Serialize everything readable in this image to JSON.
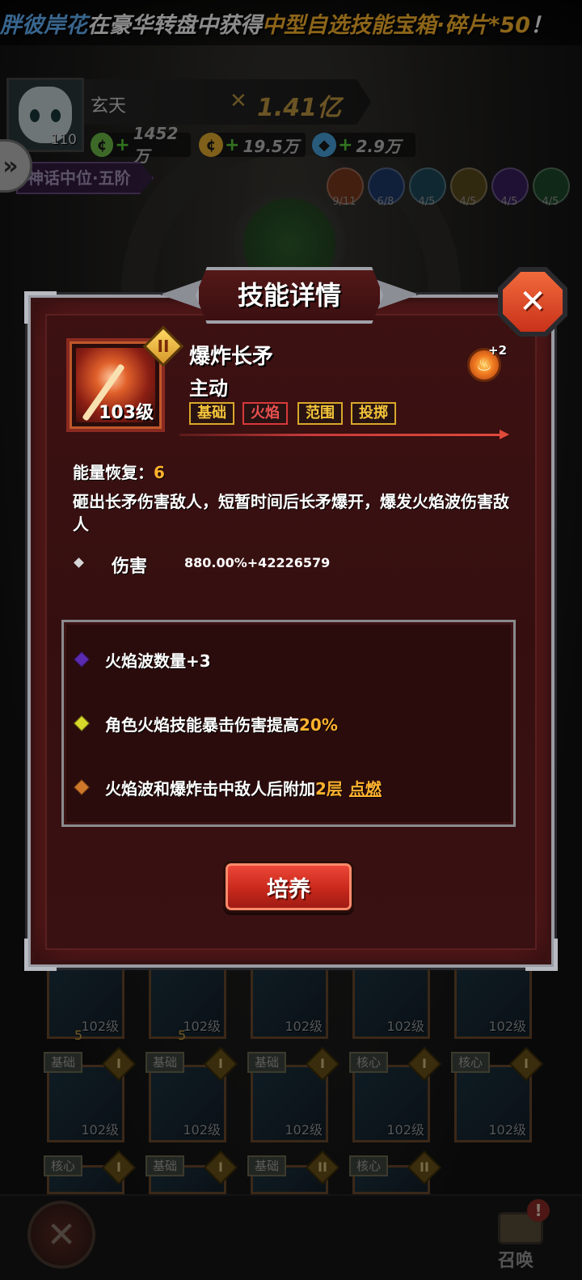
{
  "marquee": {
    "player": "胖彼岸花",
    "text1": "在豪华转盘中获得",
    "prize": "中型自选技能宝箱·碎片*50",
    "bang": "！"
  },
  "player": {
    "name": "玄天",
    "level": "110",
    "power": "1.41亿",
    "resources": [
      {
        "icon": "green-coin-icon",
        "value": "1452万",
        "color": "#6fbf4a"
      },
      {
        "icon": "gold-coin-icon",
        "value": "19.5万",
        "color": "#e8b030"
      },
      {
        "icon": "blue-crystal-icon",
        "value": "2.9万",
        "color": "#4aa6e0"
      }
    ],
    "rank": "神话中位·五阶"
  },
  "elements": [
    {
      "name": "fire",
      "count": "9/11",
      "color": "#a8502a"
    },
    {
      "name": "water",
      "count": "6/8",
      "color": "#2a5aa0"
    },
    {
      "name": "ice",
      "count": "4/5",
      "color": "#3a8aa0"
    },
    {
      "name": "light",
      "count": "4/5",
      "color": "#a08a2a"
    },
    {
      "name": "dark",
      "count": "4/5",
      "color": "#6a3a9a"
    },
    {
      "name": "wind",
      "count": "4/5",
      "color": "#3a8a4a"
    }
  ],
  "grid": {
    "levels": [
      "102级",
      "102级",
      "102级",
      "102级",
      "102级",
      "102级",
      "102级",
      "102级",
      "102级",
      "102级"
    ],
    "stars": [
      "5",
      "5"
    ],
    "tags": [
      "基础",
      "基础",
      "基础",
      "核心",
      "核心",
      "核心",
      "基础",
      "基础",
      "核心"
    ]
  },
  "modal": {
    "title": "技能详情",
    "close": "✕",
    "skill": {
      "name": "爆炸长矛",
      "type": "主动",
      "level": "103级",
      "rank": "II",
      "element_bonus": "+2",
      "tags": [
        "基础",
        "火焰",
        "范围",
        "投掷"
      ]
    },
    "energy_label": "能量恢复：",
    "energy_value": "6",
    "description": "砸出长矛伤害敌人，短暂时间后长矛爆开，爆发火焰波伤害敌人",
    "damage_label": "伤害",
    "damage_value": "880.00%+42226579",
    "effects": [
      {
        "color": "#5a2ab0",
        "text": "火焰波数量+3"
      },
      {
        "color": "#d8d82a",
        "text_prefix": "角色火焰技能暴击伤害提高",
        "highlight": "20%"
      },
      {
        "color": "#d0782a",
        "text_prefix": "火焰波和爆炸击中敌人后附加",
        "highlight": "2层",
        "link": "点燃"
      }
    ],
    "train_button": "培养"
  },
  "bottom": {
    "summon_label": "召唤",
    "alert": "!"
  }
}
